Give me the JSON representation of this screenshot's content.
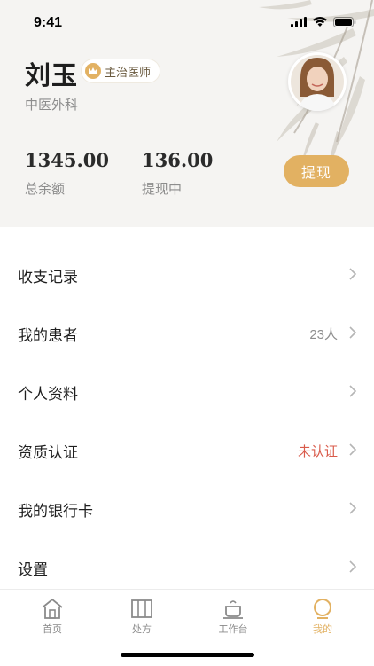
{
  "status_bar": {
    "time": "9:41"
  },
  "profile": {
    "name": "刘玉",
    "title": "主治医师",
    "department": "中医外科"
  },
  "balance": {
    "total_value": "1345.00",
    "total_label": "总余额",
    "pending_value": "136.00",
    "pending_label": "提现中",
    "withdraw_button": "提现"
  },
  "menu": [
    {
      "label": "收支记录",
      "extra": ""
    },
    {
      "label": "我的患者",
      "extra": "23人"
    },
    {
      "label": "个人资料",
      "extra": ""
    },
    {
      "label": "资质认证",
      "extra": "未认证"
    },
    {
      "label": "我的银行卡",
      "extra": ""
    },
    {
      "label": "设置",
      "extra": ""
    }
  ],
  "tabs": [
    {
      "label": "首页",
      "icon": "home-icon"
    },
    {
      "label": "处方",
      "icon": "prescription-icon"
    },
    {
      "label": "工作台",
      "icon": "workbench-icon"
    },
    {
      "label": "我的",
      "icon": "profile-icon",
      "active": true
    }
  ],
  "colors": {
    "accent": "#e2b162",
    "warning": "#d95a4a",
    "header_bg": "#f5f4f2"
  }
}
